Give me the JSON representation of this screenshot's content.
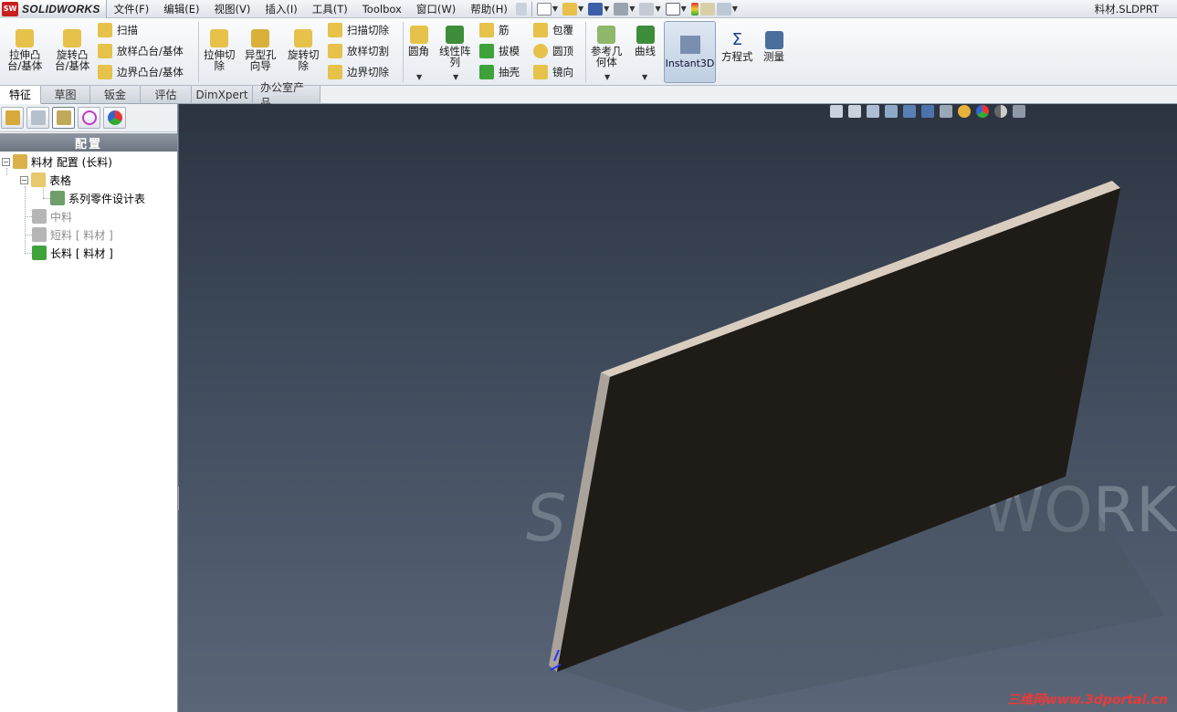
{
  "app": {
    "brand": "SOLIDWORKS",
    "document_title": "料材.SLDPRT"
  },
  "menu": [
    "文件(F)",
    "编辑(E)",
    "视图(V)",
    "插入(I)",
    "工具(T)",
    "Toolbox",
    "窗口(W)",
    "帮助(H)"
  ],
  "ribbon": {
    "extrude_boss": "拉伸凸\n台/基体",
    "revolve_boss": "旋转凸\n台/基体",
    "sweep": "扫描",
    "loft_boss": "放样凸台/基体",
    "boundary_boss": "边界凸台/基体",
    "extrude_cut": "拉伸切\n除",
    "hole_wizard": "异型孔\n向导",
    "revolve_cut": "旋转切\n除",
    "sweep_cut": "扫描切除",
    "loft_cut": "放样切割",
    "boundary_cut": "边界切除",
    "fillet": "圆角",
    "linear_pattern": "线性阵\n列",
    "rib": "筋",
    "draft": "拔模",
    "shell": "抽壳",
    "wrap": "包覆",
    "dome": "圆顶",
    "mirror": "镜向",
    "reference_geometry": "参考几\n何体",
    "curves": "曲线",
    "instant3d": "Instant3D",
    "equations": "方程式",
    "measure": "测量"
  },
  "tabs": [
    "特征",
    "草图",
    "钣金",
    "评估",
    "DimXpert",
    "办公室产品"
  ],
  "panel": {
    "header": "配置",
    "tree": {
      "root": "料材 配置  (长料)",
      "tables": "表格",
      "design_table": "系列零件设计表",
      "config_medium": "中料",
      "config_short": "短料 [ 料材 ]",
      "config_long": "长料 [ 料材 ]"
    }
  },
  "viewport": {
    "watermark": "三维网www.3dportal.cn"
  }
}
